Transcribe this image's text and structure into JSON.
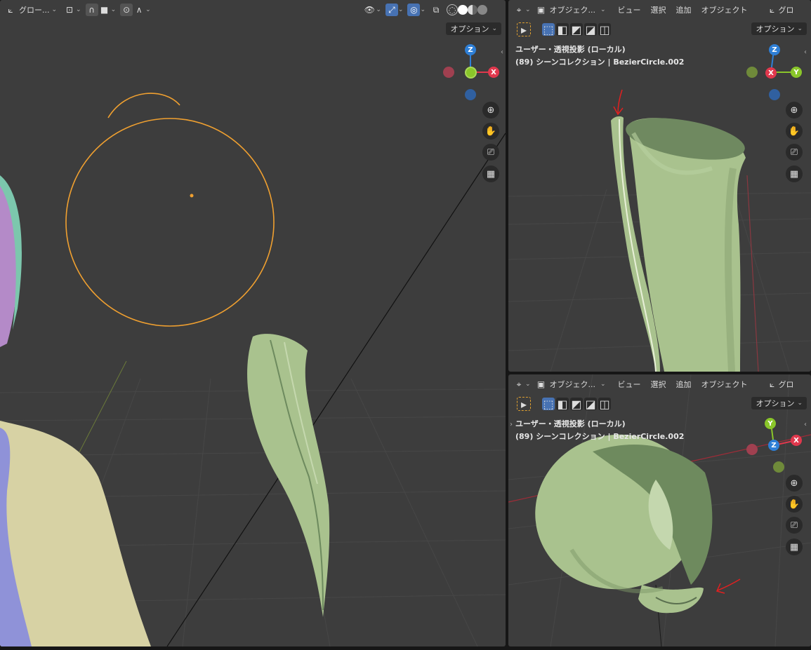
{
  "colors": {
    "viewport_bg": "#3d3d3d",
    "selected_orange": "#f0a030",
    "mesh_green": "#a9c28e",
    "skin": "#d7d2a4",
    "cloth": "#8f92d8",
    "axis_x": "#e0384d",
    "axis_y": "#8ac62a",
    "axis_z": "#2e7fd6",
    "active_blue": "#4772b3"
  },
  "main_viewport": {
    "transform_orientation": "グロー...",
    "options_label": "オプション",
    "gizmo": {
      "z": "Z",
      "x": "X"
    }
  },
  "top_viewport": {
    "mode": "オブジェク...",
    "menus": {
      "view": "ビュー",
      "select": "選択",
      "add": "追加",
      "object": "オブジェクト"
    },
    "orientation_cut": "グロ",
    "options_label": "オプション",
    "view_name": "ユーザー・透視投影 (ローカル)",
    "collection": "(89) シーンコレクション | BezierCircle.002",
    "gizmo": {
      "z": "Z",
      "x": "X",
      "y": "Y"
    }
  },
  "bottom_viewport": {
    "mode": "オブジェク...",
    "menus": {
      "view": "ビュー",
      "select": "選択",
      "add": "追加",
      "object": "オブジェクト"
    },
    "orientation_cut": "グロ",
    "options_label": "オプション",
    "view_name": "ユーザー・透視投影 (ローカル)",
    "collection": "(89) シーンコレクション | BezierCircle.002",
    "gizmo": {
      "y": "Y",
      "z": "Z",
      "x": "X"
    }
  },
  "nav_icons": [
    "zoom-icon",
    "hand-pan-icon",
    "camera-icon",
    "grid-ortho-icon"
  ]
}
